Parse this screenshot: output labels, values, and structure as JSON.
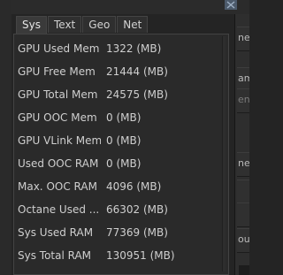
{
  "tabs": [
    {
      "label": "Sys",
      "active": true
    },
    {
      "label": "Text",
      "active": false
    },
    {
      "label": "Geo",
      "active": false
    },
    {
      "label": "Net",
      "active": false
    }
  ],
  "stats": [
    {
      "label": "GPU Used Mem",
      "value": "1322 (MB)"
    },
    {
      "label": "GPU Free Mem",
      "value": "21444 (MB)"
    },
    {
      "label": "GPU Total Mem",
      "value": "24575 (MB)"
    },
    {
      "label": "GPU OOC Mem",
      "value": "0 (MB)"
    },
    {
      "label": "GPU VLink Mem",
      "value": "0 (MB)"
    },
    {
      "label": "Used OOC RAM",
      "value": "0 (MB)"
    },
    {
      "label": "Max. OOC RAM",
      "value": "4096 (MB)"
    },
    {
      "label": "Octane Used ...",
      "value": "66302 (MB)"
    },
    {
      "label": "Sys Used RAM",
      "value": "77369 (MB)"
    },
    {
      "label": "Sys Total RAM",
      "value": "130951 (MB)"
    }
  ],
  "background_fragments": {
    "f1": "ne_",
    "f2": "am",
    "f3": "ent",
    "f4": "ne",
    "f5": "out"
  },
  "icons": {
    "corner": "close-icon",
    "handle": "resize-handle-icon"
  },
  "colors": {
    "popup_bg": "#242424",
    "panel_bg": "#2a2a2a",
    "tab_bg": "#2f2f2f",
    "active_tab_bg": "#3a3a3a",
    "text": "#cfcfcf",
    "corner_icon": "#4c5a6b"
  }
}
